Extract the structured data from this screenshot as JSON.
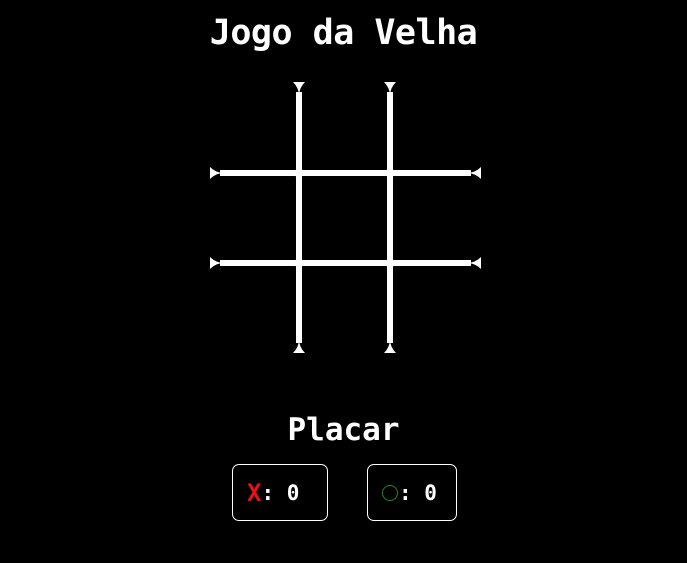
{
  "title": "Jogo da Velha",
  "board": {
    "cells": [
      "",
      "",
      "",
      "",
      "",
      "",
      "",
      "",
      ""
    ]
  },
  "scoreboard": {
    "title": "Placar",
    "x": {
      "symbol": "X",
      "separator": ": ",
      "value": "0"
    },
    "o": {
      "symbol": "O",
      "separator": ": ",
      "value": "0"
    }
  },
  "colors": {
    "background": "#000000",
    "foreground": "#ffffff",
    "x_mark": "#e8101a",
    "o_mark": "#1f8a1f"
  }
}
